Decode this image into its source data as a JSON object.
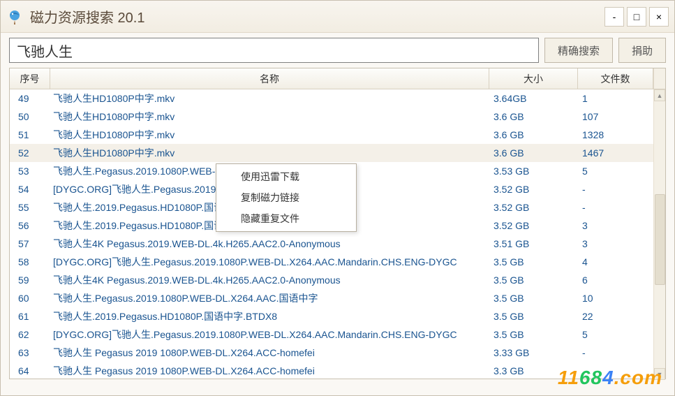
{
  "window": {
    "title": "磁力资源搜索 20.1",
    "title_extra": "        ",
    "min": "-",
    "max": "□",
    "close": "×"
  },
  "search": {
    "value": "飞驰人生",
    "placeholder": "",
    "exact_search": "精确搜索",
    "donate": "捐助"
  },
  "columns": {
    "idx": "序号",
    "name": "名称",
    "size": "大小",
    "count": "文件数"
  },
  "rows": [
    {
      "idx": "49",
      "name": "飞驰人生HD1080P中字.mkv",
      "size": "3.64GB",
      "count": "1",
      "selected": false
    },
    {
      "idx": "50",
      "name": "飞驰人生HD1080P中字.mkv",
      "size": "3.6 GB",
      "count": "107",
      "selected": false
    },
    {
      "idx": "51",
      "name": "飞驰人生HD1080P中字.mkv",
      "size": "3.6 GB",
      "count": "1328",
      "selected": false
    },
    {
      "idx": "52",
      "name": "飞驰人生HD1080P中字.mkv",
      "size": "3.6 GB",
      "count": "1467",
      "selected": true
    },
    {
      "idx": "53",
      "name": "飞驰人生.Pegasus.2019.1080P.WEB-DL.X264.AAC.CHS",
      "size": "3.53 GB",
      "count": "5",
      "selected": false
    },
    {
      "idx": "54",
      "name": "[DYGC.ORG]飞驰人生.Pegasus.2019.1080P.WEB-DL.X264.AAC",
      "size": "3.52 GB",
      "count": "-",
      "selected": false
    },
    {
      "idx": "55",
      "name": "飞驰人生.2019.Pegasus.HD1080P.国语中字.BTDX8",
      "size": "3.52 GB",
      "count": "-",
      "selected": false
    },
    {
      "idx": "56",
      "name": "飞驰人生.2019.Pegasus.HD1080P.国语中字.BTDX8",
      "size": "3.52 GB",
      "count": "3",
      "selected": false
    },
    {
      "idx": "57",
      "name": "飞驰人生4K Pegasus.2019.WEB-DL.4k.H265.AAC2.0-Anonymous",
      "size": "3.51 GB",
      "count": "3",
      "selected": false
    },
    {
      "idx": "58",
      "name": "[DYGC.ORG]飞驰人生.Pegasus.2019.1080P.WEB-DL.X264.AAC.Mandarin.CHS.ENG-DYGC",
      "size": "3.5 GB",
      "count": "4",
      "selected": false
    },
    {
      "idx": "59",
      "name": "飞驰人生4K Pegasus.2019.WEB-DL.4k.H265.AAC2.0-Anonymous",
      "size": "3.5 GB",
      "count": "6",
      "selected": false
    },
    {
      "idx": "60",
      "name": "飞驰人生.Pegasus.2019.1080P.WEB-DL.X264.AAC.国语中字",
      "size": "3.5 GB",
      "count": "10",
      "selected": false
    },
    {
      "idx": "61",
      "name": "飞驰人生.2019.Pegasus.HD1080P.国语中字.BTDX8",
      "size": "3.5 GB",
      "count": "22",
      "selected": false
    },
    {
      "idx": "62",
      "name": "[DYGC.ORG]飞驰人生.Pegasus.2019.1080P.WEB-DL.X264.AAC.Mandarin.CHS.ENG-DYGC",
      "size": "3.5 GB",
      "count": "5",
      "selected": false
    },
    {
      "idx": "63",
      "name": "飞驰人生 Pegasus 2019 1080P.WEB-DL.X264.ACC-homefei",
      "size": "3.33 GB",
      "count": "-",
      "selected": false
    },
    {
      "idx": "64",
      "name": "飞驰人生 Pegasus 2019 1080P.WEB-DL.X264.ACC-homefei",
      "size": "3.3 GB",
      "count": "",
      "selected": false
    }
  ],
  "context_menu": [
    "使用迅雷下载",
    "复制磁力链接",
    "隐藏重复文件"
  ],
  "watermark": "11684.com"
}
